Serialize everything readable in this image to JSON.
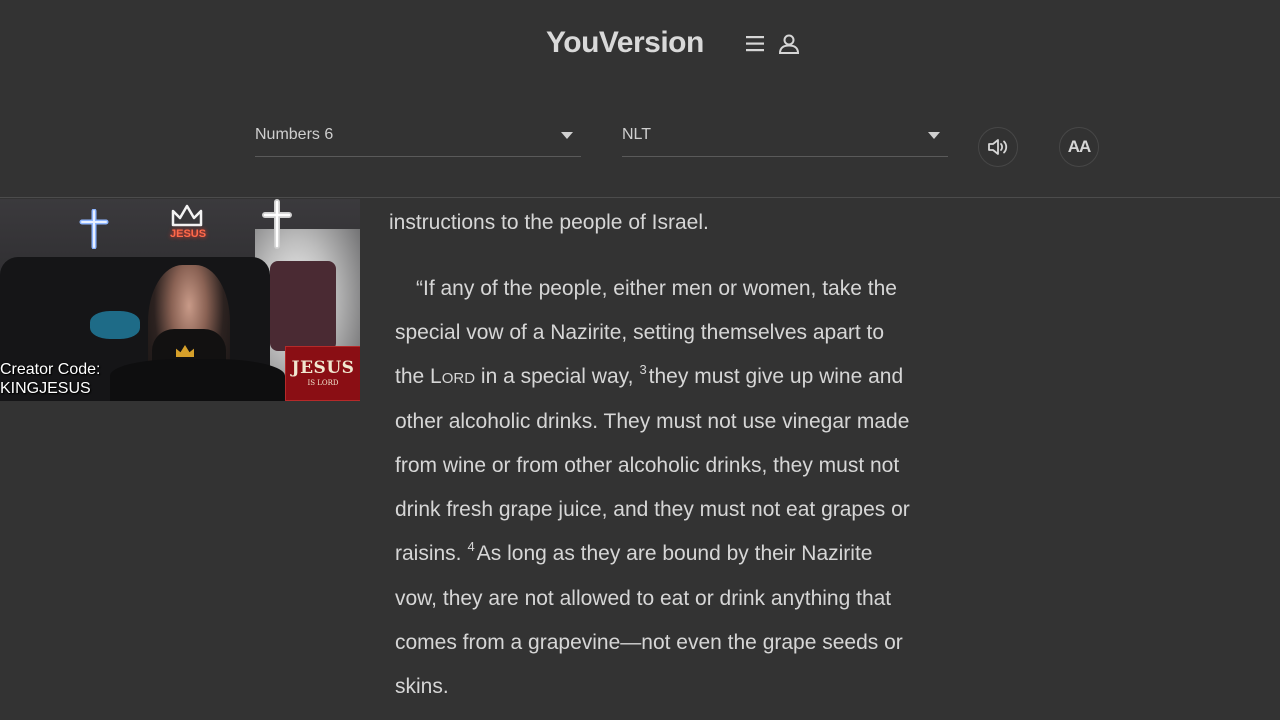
{
  "header": {
    "brand": "YouVersion",
    "menu_icon": "hamburger-menu-icon",
    "profile_icon": "user-profile-icon"
  },
  "selectors": {
    "book": "Numbers 6",
    "version": "NLT"
  },
  "controls": {
    "audio_icon": "speaker-volume-icon",
    "font_size_label": "AA"
  },
  "webcam": {
    "creator_code_label": "Creator Code:",
    "creator_code_value": "KINGJESUS",
    "sign_big": "JESUS",
    "sign_small": "IS LORD",
    "neon_word": "JESUS"
  },
  "scripture": {
    "lines": [
      "instructions to the people of Israel.",
      "“If any of the people, either men or women, take the",
      "special vow of a Nazirite, setting themselves apart to",
      "the",
      "Lord",
      "in a special way,",
      "3",
      "they must give up wine and",
      "other alcoholic drinks. They must not use vinegar made",
      "from wine or from other alcoholic drinks, they must not",
      "drink fresh grape juice, and they must not eat grapes or",
      "raisins.",
      "4",
      "As long as they are bound by their Nazirite",
      "vow, they are not allowed to eat or drink anything that",
      "comes from a grapevine—not even the grape seeds or",
      "skins."
    ]
  },
  "colors": {
    "background": "#333333",
    "text": "#d6d6d6",
    "sign_red": "#8a0e14"
  }
}
